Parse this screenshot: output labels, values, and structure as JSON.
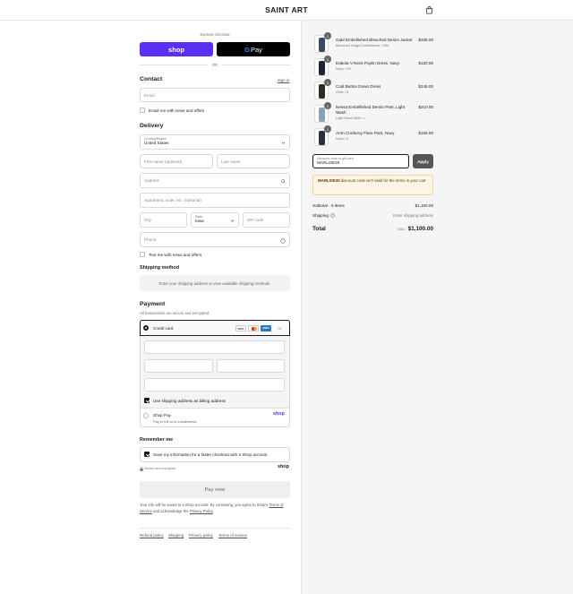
{
  "brand": "SAINT ART",
  "icons": {
    "bag": "shopping-bag-icon",
    "search": "search-icon",
    "help": "help-circle-icon",
    "chevron": "chevron-down-icon",
    "lock": "lock-icon"
  },
  "express": {
    "label": "Express checkout",
    "shop": "shop",
    "gpay_g": "G",
    "gpay": "Pay",
    "or": "OR"
  },
  "contact": {
    "title": "Contact",
    "sign_in": "Sign in",
    "email_placeholder": "Email",
    "news": "Email me with news and offers"
  },
  "delivery": {
    "title": "Delivery",
    "country_label": "Country/Region",
    "country": "United States",
    "first_name": "First name (optional)",
    "last_name": "Last name",
    "address": "Address",
    "apartment": "Apartment, suite, etc. (optional)",
    "city": "City",
    "state_label": "State",
    "state": "Iowa",
    "zip": "ZIP code",
    "phone": "Phone",
    "text_me": "Text me with news and offers"
  },
  "shipping_method": {
    "title": "Shipping method",
    "message": "Enter your shipping address to view available shipping methods."
  },
  "payment": {
    "title": "Payment",
    "subtitle": "All transactions are secure and encrypted.",
    "credit_card": "Credit card",
    "cards": [
      "VISA",
      "MC",
      "AMEX",
      "+4"
    ],
    "billing_same": "Use shipping address as billing address",
    "shop_pay": "Shop Pay",
    "shop_pay_sub": "Pay in full or in installments",
    "shop_pay_logo": "shop"
  },
  "remember": {
    "title": "Remember me",
    "save_info": "Save my information for a faster checkout with a Shop account",
    "secure": "Secure and encrypted",
    "shop_logo": "shop"
  },
  "pay_now": "Pay now",
  "legal": {
    "text": "Your info will be saved to a Shop account. By continuing, you agree to Shop's",
    "terms": "Terms of Service",
    "and": "and acknowledge the",
    "privacy": "Privacy Policy",
    "end": "."
  },
  "footer_links": [
    "Refund policy",
    "Shipping",
    "Privacy policy",
    "Terms of service"
  ],
  "items": [
    {
      "qty": "1",
      "name": "Gabi Embellished Bleached Denim Jacket",
      "variant": "Bleached Indigo Embellished / S/M",
      "price": "$335.00",
      "color": "#3d4a60"
    },
    {
      "qty": "1",
      "name": "Dakota V-Neck Poplin Dress, Navy",
      "variant": "Navy / XS",
      "price": "$120.00",
      "color": "#1e2438"
    },
    {
      "qty": "1",
      "name": "Codi Button Down Dress",
      "variant": "Olive / S",
      "price": "$245.00",
      "color": "#2e2a22"
    },
    {
      "qty": "1",
      "name": "Nessa Embellished Denim Pant, Light Wash",
      "variant": "Light Wash Multi / L",
      "price": "$210.00",
      "color": "#8aa0b8"
    },
    {
      "qty": "1",
      "name": "Aron Corduroy Flare Pant, Navy",
      "variant": "Navy / 0",
      "price": "$165.00",
      "color": "#2a3040"
    }
  ],
  "discount": {
    "label": "Discount code or gift card",
    "value": "MARLISE30",
    "apply": "Apply",
    "error_code": "MARLISE30",
    "error_msg": "discount code isn't valid for the items in your cart"
  },
  "summary": {
    "subtotal_label": "Subtotal · 5 items",
    "subtotal": "$1,100.00",
    "shipping_label": "Shipping",
    "shipping": "Enter shipping address",
    "total_label": "Total",
    "currency": "USD",
    "total": "$1,100.00"
  }
}
